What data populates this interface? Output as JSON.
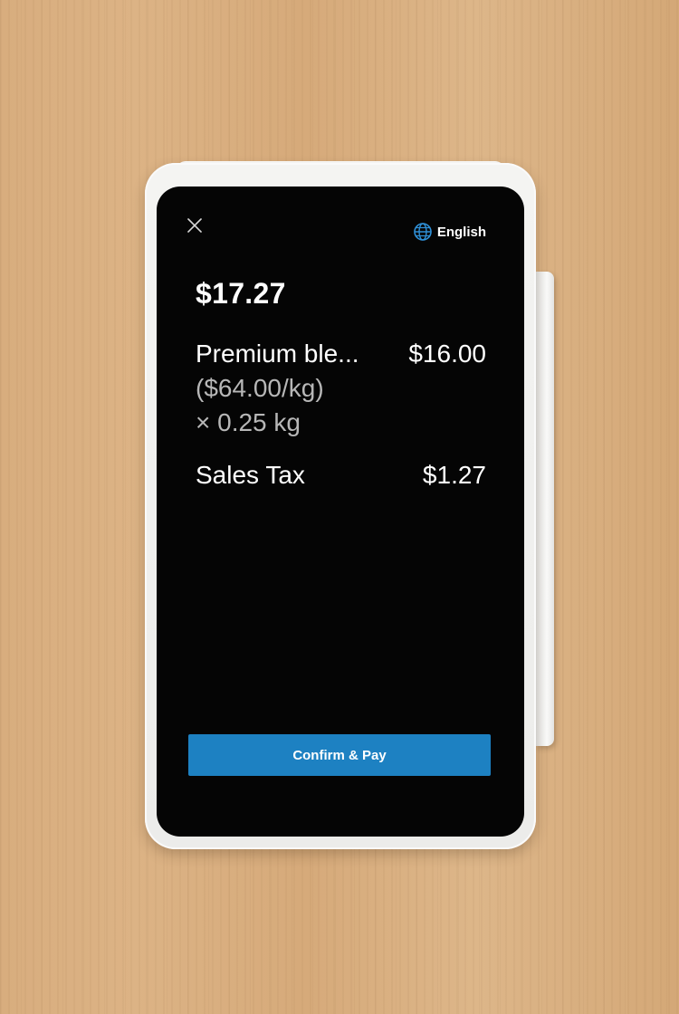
{
  "header": {
    "close_icon": "close-icon",
    "language_icon": "globe-icon",
    "language_label": "English"
  },
  "total": {
    "amount": "$17.27"
  },
  "line_items": [
    {
      "name": "Premium ble...",
      "price": "$16.00",
      "unit_price": "($64.00/kg)",
      "quantity": "× 0.25 kg"
    },
    {
      "name": "Sales Tax",
      "price": "$1.27"
    }
  ],
  "actions": {
    "confirm_pay_label": "Confirm & Pay"
  },
  "colors": {
    "screen_background": "#050505",
    "primary_button": "#1d81c2",
    "secondary_text": "#b7b7b7",
    "device_body": "#f2f2f0"
  }
}
